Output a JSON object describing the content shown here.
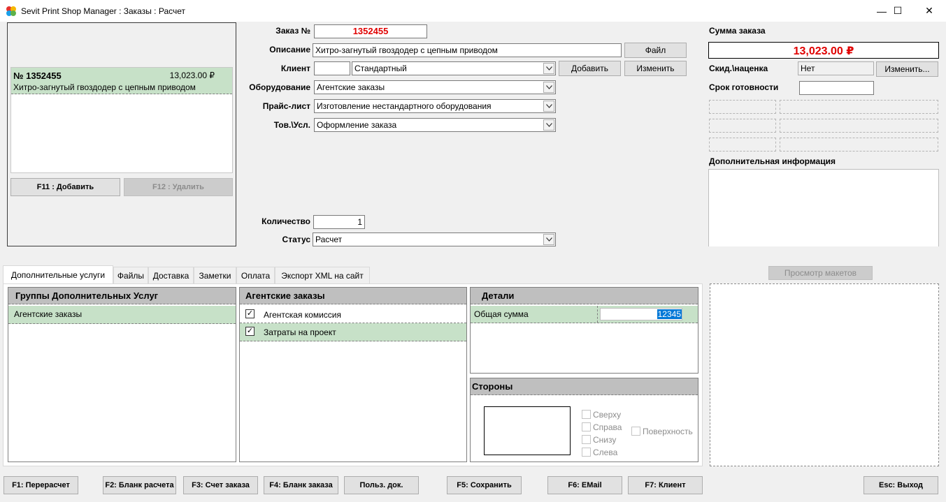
{
  "window": {
    "title": "Sevit Print Shop Manager : Заказы : Расчет",
    "minimize": "—",
    "maximize": "☐",
    "close": "✕"
  },
  "order_list": {
    "items": [
      {
        "number": "№ 1352455",
        "amount": "13,023.00 ₽",
        "description": "Хитро-загнутый гвоздодер с цепным приводом"
      }
    ],
    "add_button": "F11 : Добавить",
    "delete_button": "F12 : Удалить"
  },
  "form": {
    "order_no_label": "Заказ №",
    "order_no_value": "1352455",
    "description_label": "Описание",
    "description_value": "Хитро-загнутый гвоздодер с цепным приводом",
    "file_button": "Файл",
    "client_label": "Клиент",
    "client_code": "",
    "client_value": "Стандартный",
    "add_button": "Добавить",
    "edit_button": "Изменить",
    "equipment_label": "Оборудование",
    "equipment_value": "Агентские заказы",
    "pricelist_label": "Прайс-лист",
    "pricelist_value": "Изготовление нестандартного оборудования",
    "product_label": "Тов.\\Усл.",
    "product_value": "Оформление заказа",
    "quantity_label": "Количество",
    "quantity_value": "1",
    "status_label": "Статус",
    "status_value": "Расчет"
  },
  "summary": {
    "total_label": "Сумма заказа",
    "total_value": "13,023.00 ₽",
    "discount_label": "Скид.\\наценка",
    "discount_value": "Нет",
    "discount_button": "Изменить...",
    "deadline_label": "Срок готовности",
    "deadline_value": "",
    "extra_info_label": "Дополнительная информация",
    "preview_button": "Просмотр макетов"
  },
  "tabs": [
    "Дополнительные услуги",
    "Файлы",
    "Доставка",
    "Заметки",
    "Оплата",
    "Экспорт XML на сайт"
  ],
  "services": {
    "groups_header": "Группы Дополнительных Услуг",
    "groups": [
      "Агентские заказы"
    ],
    "items_header": "Агентские заказы",
    "items": [
      {
        "label": "Агентская комиссия",
        "checked": true
      },
      {
        "label": "Затраты на проект",
        "checked": true
      }
    ],
    "details_header": "Детали",
    "details_label": "Общая сумма",
    "details_value": "12345",
    "sides_header": "Стороны",
    "sides": [
      "Сверху",
      "Справа",
      "Снизу",
      "Слева"
    ],
    "surface": "Поверхность"
  },
  "footer": {
    "recalc": "F1: Перерасчет",
    "calc_form": "F2: Бланк расчета",
    "invoice": "F3: Счет заказа",
    "order_form": "F4: Бланк заказа",
    "user_docs": "Польз. док.",
    "save": "F5: Сохранить",
    "email": "F6: EMail",
    "client": "F7: Клиент",
    "exit": "Esc: Выход"
  },
  "colors": {
    "accent_red": "#e00000",
    "selection_green": "#c7e1c8",
    "panel_header": "#bfbfbf",
    "highlight_blue": "#0078d7"
  }
}
